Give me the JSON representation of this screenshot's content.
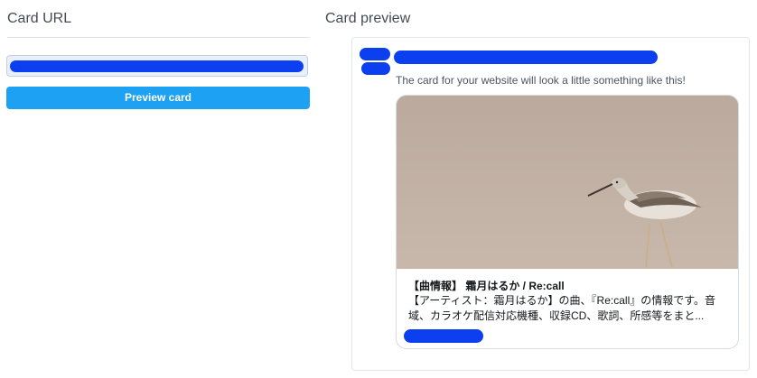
{
  "left_panel": {
    "heading": "Card URL",
    "url_value": "",
    "preview_button_label": "Preview card"
  },
  "right_panel": {
    "heading": "Card preview",
    "tweet": {
      "text": "The card for your website will look a little something like this!",
      "card": {
        "title": "【曲情報】 霜月はるか / Re:call",
        "description": "【アーティスト：霜月はるか】の曲、『Re:call』の情報です。音域、カラオケ配信対応機種、収録CD、歌詞、所感等をまと...",
        "image": "bird-photo"
      }
    }
  },
  "colors": {
    "accent": "#1da1f2",
    "redaction": "#0b3ff0",
    "image_background": "#bfada1"
  }
}
